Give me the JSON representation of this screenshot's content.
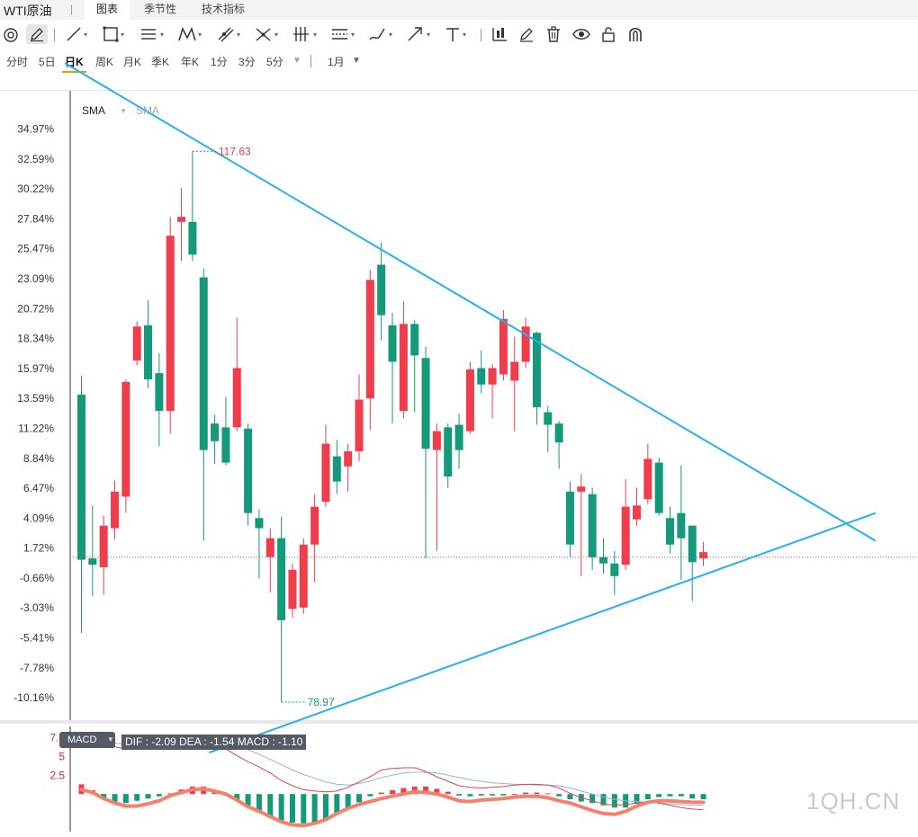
{
  "tabs": {
    "title": "WTI原油",
    "items": [
      "图表",
      "季节性",
      "技术指标"
    ],
    "active_index": 0
  },
  "toolbar": {
    "tools": [
      "magnet-icon",
      "pencil-icon",
      "line-icon",
      "rectangle-icon",
      "parallel-lines-icon",
      "zigzag-icon",
      "trend-tool-icon",
      "cross-tool-icon",
      "vertical-lines-icon",
      "channel-icon",
      "brush-icon",
      "arrow-icon",
      "text-icon",
      "indicator-icon",
      "edit-icon",
      "trash-icon",
      "eye-icon",
      "lock-icon",
      "magnet-u-icon"
    ]
  },
  "periods": {
    "items": [
      "分时",
      "5日",
      "日K",
      "周K",
      "月K",
      "季K",
      "年K",
      "1分",
      "3分",
      "5分"
    ],
    "active": "日K",
    "more_caret": "▼",
    "range": "1月",
    "range_caret": "▼"
  },
  "indicators": {
    "main": "SMA",
    "main_secondary": "SMA",
    "sub": "MACD",
    "macd_readout": "DIF : -2.09   DEA : -1.54   MACD : -1.10"
  },
  "watermark": "1QH.CN",
  "colors": {
    "up": "#ef3d4c",
    "down": "#14997a",
    "trendline": "#24b1ee",
    "macd_line": "#f5806b"
  },
  "chart_data": {
    "type": "candlestick",
    "y_axis_unit": "%",
    "y_ticks": [
      "34.97%",
      "32.59%",
      "30.22%",
      "27.84%",
      "25.47%",
      "23.09%",
      "20.72%",
      "18.34%",
      "15.97%",
      "13.59%",
      "11.22%",
      "8.84%",
      "6.47%",
      "4.09%",
      "1.72%",
      "-0.66%",
      "-3.03%",
      "-5.41%",
      "-7.78%",
      "-10.16%"
    ],
    "ylim": [
      -12,
      38
    ],
    "reference_level": 1.0,
    "annotations": {
      "high": "117.63",
      "low": "78.97"
    },
    "candles": [
      {
        "o": 13.9,
        "c": 0.8,
        "h": 15.4,
        "l": -5.0
      },
      {
        "o": 0.9,
        "c": 0.4,
        "h": 5.1,
        "l": -2.1
      },
      {
        "o": 0.2,
        "c": 3.5,
        "h": 4.3,
        "l": -2.0
      },
      {
        "o": 3.3,
        "c": 6.2,
        "h": 7.1,
        "l": 2.4
      },
      {
        "o": 5.8,
        "c": 14.9,
        "h": 15.1,
        "l": 4.5
      },
      {
        "o": 16.6,
        "c": 19.3,
        "h": 19.7,
        "l": 16.2
      },
      {
        "o": 19.4,
        "c": 15.1,
        "h": 21.4,
        "l": 14.4
      },
      {
        "o": 15.6,
        "c": 12.6,
        "h": 17.2,
        "l": 9.8
      },
      {
        "o": 12.6,
        "c": 26.5,
        "h": 28.0,
        "l": 10.8
      },
      {
        "o": 27.6,
        "c": 28.0,
        "h": 30.3,
        "l": 24.5
      },
      {
        "o": 27.6,
        "c": 25.0,
        "h": 33.2,
        "l": 24.5
      },
      {
        "o": 23.2,
        "c": 9.5,
        "h": 23.9,
        "l": 2.3
      },
      {
        "o": 11.6,
        "c": 10.2,
        "h": 12.3,
        "l": 8.4
      },
      {
        "o": 11.3,
        "c": 8.5,
        "h": 13.7,
        "l": 8.3
      },
      {
        "o": 11.3,
        "c": 16.0,
        "h": 20.0,
        "l": 11.0
      },
      {
        "o": 11.2,
        "c": 4.5,
        "h": 11.6,
        "l": 3.5
      },
      {
        "o": 4.1,
        "c": 3.3,
        "h": 4.8,
        "l": -0.7
      },
      {
        "o": 1.0,
        "c": 2.5,
        "h": 3.3,
        "l": -1.8
      },
      {
        "o": 2.5,
        "c": -4.0,
        "h": 4.2,
        "l": -10.5
      },
      {
        "o": -3.1,
        "c": 0.0,
        "h": 0.5,
        "l": -3.8
      },
      {
        "o": -3.0,
        "c": 2.0,
        "h": 2.5,
        "l": -3.5
      },
      {
        "o": 2.0,
        "c": 5.0,
        "h": 6.0,
        "l": -1.0
      },
      {
        "o": 5.4,
        "c": 10.0,
        "h": 11.5,
        "l": 5.0
      },
      {
        "o": 9.0,
        "c": 7.0,
        "h": 10.3,
        "l": 6.0
      },
      {
        "o": 8.2,
        "c": 9.4,
        "h": 10.0,
        "l": 6.2
      },
      {
        "o": 9.4,
        "c": 13.5,
        "h": 15.5,
        "l": 8.6
      },
      {
        "o": 13.6,
        "c": 23.0,
        "h": 23.8,
        "l": 11.1
      },
      {
        "o": 24.2,
        "c": 20.2,
        "h": 26.0,
        "l": 18.2
      },
      {
        "o": 19.4,
        "c": 16.5,
        "h": 20.4,
        "l": 11.6
      },
      {
        "o": 12.6,
        "c": 19.5,
        "h": 21.3,
        "l": 12.0
      },
      {
        "o": 19.5,
        "c": 17.0,
        "h": 19.8,
        "l": 12.5
      },
      {
        "o": 16.8,
        "c": 9.6,
        "h": 17.7,
        "l": 0.9
      },
      {
        "o": 9.5,
        "c": 11.0,
        "h": 11.6,
        "l": 1.5
      },
      {
        "o": 11.3,
        "c": 7.4,
        "h": 11.6,
        "l": 6.5
      },
      {
        "o": 11.5,
        "c": 9.5,
        "h": 12.4,
        "l": 8.0
      },
      {
        "o": 11.0,
        "c": 15.9,
        "h": 16.5,
        "l": 10.8
      },
      {
        "o": 16.0,
        "c": 14.7,
        "h": 17.4,
        "l": 14.0
      },
      {
        "o": 14.7,
        "c": 16.0,
        "h": 16.3,
        "l": 12.0
      },
      {
        "o": 15.5,
        "c": 19.9,
        "h": 20.6,
        "l": 15.0
      },
      {
        "o": 15.0,
        "c": 16.5,
        "h": 18.5,
        "l": 11.0
      },
      {
        "o": 16.5,
        "c": 19.3,
        "h": 20.0,
        "l": 16.0
      },
      {
        "o": 18.8,
        "c": 12.9,
        "h": 18.9,
        "l": 11.5
      },
      {
        "o": 12.5,
        "c": 11.5,
        "h": 13.0,
        "l": 9.3
      },
      {
        "o": 11.6,
        "c": 10.1,
        "h": 11.8,
        "l": 8.0
      },
      {
        "o": 6.2,
        "c": 2.0,
        "h": 7.0,
        "l": 1.0
      },
      {
        "o": 6.2,
        "c": 6.6,
        "h": 7.6,
        "l": -0.5
      },
      {
        "o": 6.0,
        "c": 1.0,
        "h": 6.5,
        "l": 0.0
      },
      {
        "o": 1.0,
        "c": 0.5,
        "h": 2.5,
        "l": -0.3
      },
      {
        "o": 0.5,
        "c": -0.5,
        "h": 1.5,
        "l": -2.0
      },
      {
        "o": 0.4,
        "c": 5.0,
        "h": 7.2,
        "l": 0.0
      },
      {
        "o": 4.0,
        "c": 5.1,
        "h": 6.5,
        "l": 3.5
      },
      {
        "o": 5.6,
        "c": 8.8,
        "h": 10.0,
        "l": 5.2
      },
      {
        "o": 8.5,
        "c": 4.5,
        "h": 8.9,
        "l": 4.3
      },
      {
        "o": 4.1,
        "c": 2.0,
        "h": 5.0,
        "l": 1.3
      },
      {
        "o": 4.5,
        "c": 2.5,
        "h": 8.3,
        "l": -0.8
      },
      {
        "o": 3.5,
        "c": 0.6,
        "h": 3.5,
        "l": -2.5
      },
      {
        "o": 0.9,
        "c": 1.4,
        "h": 2.2,
        "l": 0.3
      }
    ],
    "trendlines": [
      {
        "name": "upper",
        "from": {
          "bar": -1.5,
          "y": 40.2
        },
        "to": {
          "bar": 71.5,
          "y": 2.3
        }
      },
      {
        "name": "lower",
        "from": {
          "bar": 11.5,
          "y": -14.5
        },
        "to": {
          "bar": 71.5,
          "y": 4.5
        }
      }
    ],
    "macd": {
      "y_ticks": [
        "7.5",
        "5",
        "2.5"
      ],
      "ylim": [
        -5,
        9
      ],
      "histogram": [
        1.3,
        0.5,
        -0.5,
        -1.0,
        -1.2,
        -0.9,
        -0.6,
        -0.3,
        0.1,
        0.6,
        1.0,
        1.0,
        0.5,
        -0.2,
        -0.8,
        -1.5,
        -2.2,
        -3.0,
        -3.5,
        -3.8,
        -3.9,
        -3.8,
        -3.3,
        -2.6,
        -1.8,
        -1.1,
        -0.3,
        0.2,
        0.5,
        0.8,
        1.0,
        1.0,
        0.7,
        0.3,
        -0.2,
        -0.3,
        -0.2,
        -0.2,
        -0.2,
        0.0,
        0.2,
        0.2,
        0.1,
        -0.3,
        -0.7,
        -1.0,
        -1.2,
        -1.5,
        -1.8,
        -1.8,
        -1.3,
        -0.7,
        -0.4,
        -0.3,
        -0.3,
        -0.6,
        -0.7
      ],
      "dif": [
        7.6,
        7.8,
        7.1,
        6.3,
        6.0,
        6.5,
        6.8,
        7.0,
        6.6,
        6.8,
        7.3,
        7.6,
        6.9,
        6.0,
        5.1,
        4.3,
        3.6,
        2.8,
        1.8,
        1.1,
        0.6,
        0.4,
        0.3,
        0.4,
        0.9,
        1.6,
        2.3,
        3.2,
        3.4,
        3.5,
        3.5,
        3.0,
        2.3,
        1.7,
        1.1,
        0.9,
        0.8,
        0.9,
        1.0,
        1.2,
        1.3,
        1.3,
        1.2,
        0.8,
        0.1,
        -0.5,
        -0.9,
        -1.3,
        -1.5,
        -1.4,
        -1.2,
        -1.0,
        -1.2,
        -1.5,
        -1.8,
        -2.0,
        -2.1
      ],
      "dea": [
        7.0,
        7.1,
        7.0,
        6.8,
        6.6,
        6.6,
        6.6,
        6.7,
        6.7,
        6.8,
        6.9,
        7.0,
        7.0,
        6.8,
        6.4,
        5.9,
        5.3,
        4.6,
        3.9,
        3.2,
        2.6,
        2.1,
        1.6,
        1.3,
        1.2,
        1.4,
        1.7,
        2.2,
        2.5,
        2.8,
        2.9,
        2.9,
        2.8,
        2.5,
        2.2,
        1.9,
        1.7,
        1.5,
        1.4,
        1.3,
        1.3,
        1.2,
        1.2,
        1.1,
        0.8,
        0.4,
        0.0,
        -0.4,
        -0.7,
        -0.9,
        -1.0,
        -1.1,
        -1.2,
        -1.3,
        -1.4,
        -1.5,
        -1.5
      ],
      "macd_line": [
        0.6,
        0.2,
        -0.6,
        -1.2,
        -1.6,
        -1.6,
        -1.3,
        -0.9,
        -0.2,
        0.2,
        0.6,
        0.7,
        0.4,
        0.0,
        -0.8,
        -1.7,
        -2.3,
        -3.0,
        -3.7,
        -4.1,
        -4.2,
        -3.9,
        -3.4,
        -2.6,
        -1.9,
        -1.4,
        -1.0,
        -0.6,
        -0.3,
        0.0,
        0.3,
        0.2,
        0.0,
        -0.4,
        -0.9,
        -1.0,
        -0.8,
        -0.7,
        -0.6,
        -0.4,
        -0.3,
        -0.3,
        -0.5,
        -0.9,
        -1.2,
        -1.7,
        -2.2,
        -2.6,
        -2.7,
        -2.3,
        -1.6,
        -1.1,
        -0.9,
        -0.9,
        -1.0,
        -1.1,
        -1.1
      ]
    }
  }
}
